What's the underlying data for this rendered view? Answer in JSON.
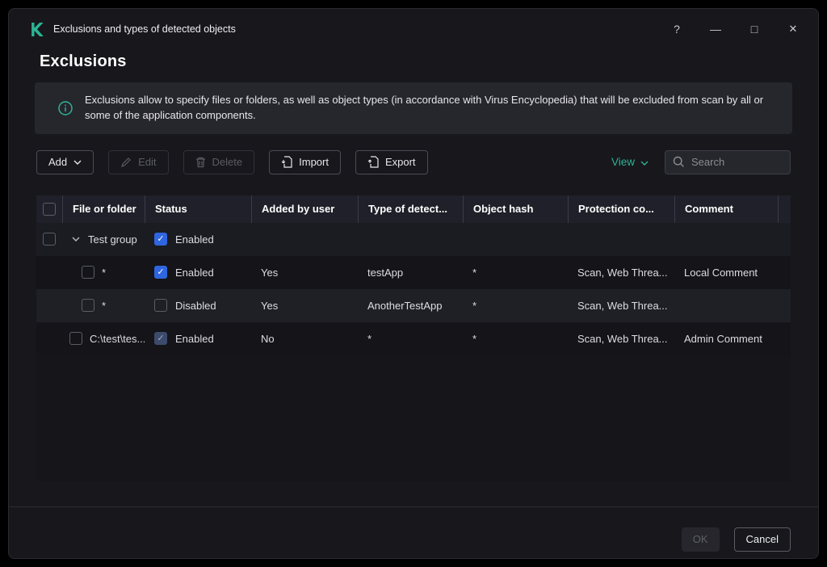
{
  "window": {
    "title": "Exclusions and types of detected objects",
    "controls": {
      "help": "?",
      "minimize": "—",
      "maximize": "□",
      "close": "✕"
    }
  },
  "page": {
    "title": "Exclusions"
  },
  "banner": {
    "text": "Exclusions allow to specify files or folders, as well as object types (in accordance with Virus Encyclopedia) that will be excluded from scan by all or some of the application components."
  },
  "toolbar": {
    "add_label": "Add",
    "edit_label": "Edit",
    "delete_label": "Delete",
    "import_label": "Import",
    "export_label": "Export",
    "view_label": "View",
    "search_placeholder": "Search"
  },
  "table": {
    "columns": [
      "File or folder",
      "Status",
      "Added by user",
      "Type of detect...",
      "Object hash",
      "Protection co...",
      "Comment"
    ],
    "group": {
      "name": "Test group",
      "status": "Enabled",
      "enabled": true
    },
    "rows": [
      {
        "file": "*",
        "status": "Enabled",
        "enabled": true,
        "inherited": false,
        "added_by_user": "Yes",
        "type": "testApp",
        "hash": "*",
        "protection": "Scan, Web Threa...",
        "comment": "Local Comment"
      },
      {
        "file": "*",
        "status": "Disabled",
        "enabled": false,
        "inherited": false,
        "added_by_user": "Yes",
        "type": "AnotherTestApp",
        "hash": "*",
        "protection": "Scan, Web Threa...",
        "comment": ""
      },
      {
        "file": "C:\\test\\tes...",
        "status": "Enabled",
        "enabled": true,
        "inherited": true,
        "added_by_user": "No",
        "type": "*",
        "hash": "*",
        "protection": "Scan, Web Threa...",
        "comment": "Admin Comment"
      }
    ]
  },
  "footer": {
    "ok_label": "OK",
    "cancel_label": "Cancel"
  },
  "colors": {
    "accent": "#2db394",
    "checkbox_checked": "#2f66e0",
    "window_bg": "#17171c"
  }
}
